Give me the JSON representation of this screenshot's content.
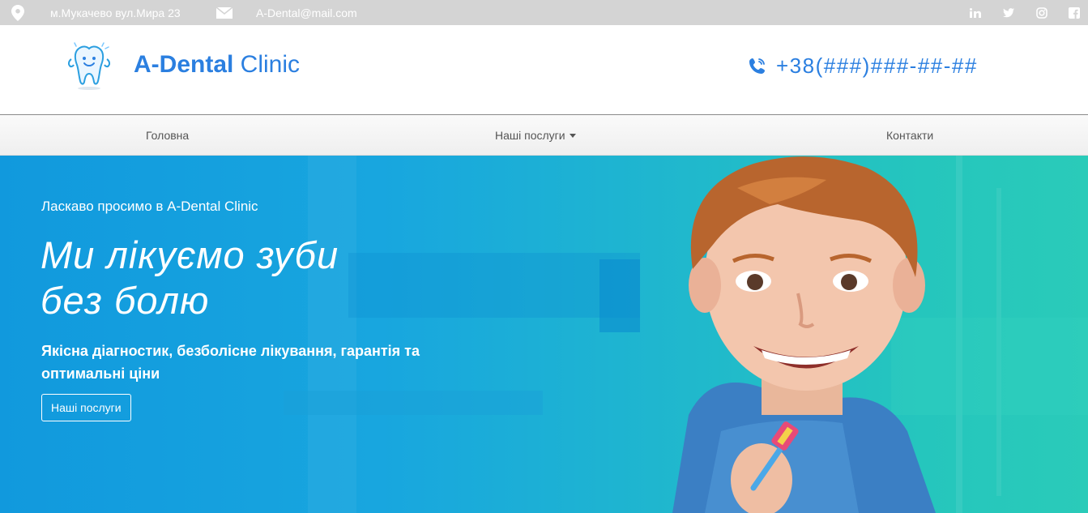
{
  "topbar": {
    "address": "м.Мукачево вул.Мира 23",
    "email": "A-Dental@mail.com",
    "social_icons": [
      "linkedin-icon",
      "twitter-icon",
      "instagram-icon",
      "facebook-icon"
    ],
    "social_labels": [
      "in",
      "t",
      "ig",
      "f"
    ]
  },
  "header": {
    "brand_bold": "A-Dental",
    "brand_rest": " Clinic",
    "phone": "+38(###)###-##-##"
  },
  "nav": {
    "items": [
      "Головна",
      "Наші послуги",
      "Контакти"
    ]
  },
  "hero": {
    "welcome": "Ласкаво просимо в A-Dental Clinic",
    "title_line1": "Ми лікуємо зуби",
    "title_line2": "без болю",
    "subtitle": "Якісна діагностик, безболісне лікування, гарантія та оптимальні ціни",
    "button": "Наші послуги"
  },
  "colors": {
    "brand_blue": "#2b7fe0",
    "topbar_gray": "#d4d4d4",
    "hero_blue": "#1199dd",
    "hero_teal": "#2acbb9"
  }
}
